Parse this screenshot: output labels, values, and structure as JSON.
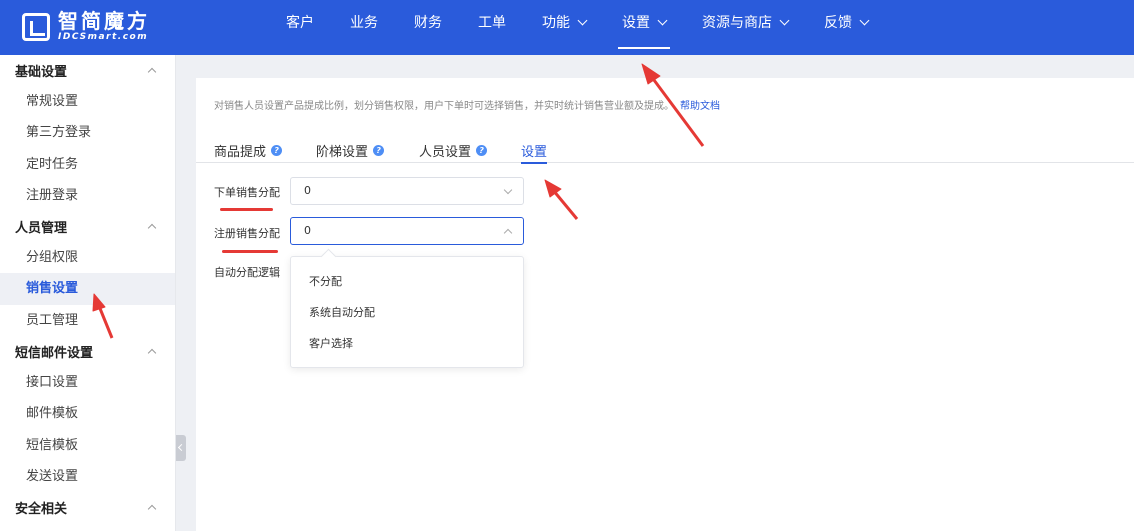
{
  "logo": {
    "title": "智简魔方",
    "subtitle": "IDCSmart.com"
  },
  "nav": [
    {
      "label": "客户",
      "dropdown": false,
      "active": false
    },
    {
      "label": "业务",
      "dropdown": false,
      "active": false
    },
    {
      "label": "财务",
      "dropdown": false,
      "active": false
    },
    {
      "label": "工单",
      "dropdown": false,
      "active": false
    },
    {
      "label": "功能",
      "dropdown": true,
      "active": false
    },
    {
      "label": "设置",
      "dropdown": true,
      "active": true
    },
    {
      "label": "资源与商店",
      "dropdown": true,
      "active": false
    },
    {
      "label": "反馈",
      "dropdown": true,
      "active": false
    }
  ],
  "sidebar": {
    "groups": [
      {
        "title": "基础设置",
        "items": [
          "常规设置",
          "第三方登录",
          "定时任务",
          "注册登录"
        ]
      },
      {
        "title": "人员管理",
        "items": [
          "分组权限",
          "销售设置",
          "员工管理"
        ]
      },
      {
        "title": "短信邮件设置",
        "items": [
          "接口设置",
          "邮件模板",
          "短信模板",
          "发送设置"
        ]
      },
      {
        "title": "安全相关",
        "items": []
      }
    ],
    "active_item": "销售设置"
  },
  "main": {
    "description": "对销售人员设置产品提成比例，划分销售权限，用户下单时可选择销售，并实时统计销售营业额及提成。",
    "help_link": "帮助文档",
    "tabs": [
      {
        "label": "商品提成",
        "help": true
      },
      {
        "label": "阶梯设置",
        "help": true
      },
      {
        "label": "人员设置",
        "help": true
      },
      {
        "label": "设置",
        "help": false
      }
    ],
    "active_tab": "设置",
    "form": {
      "order_sales_label": "下单销售分配",
      "order_sales_value": "0",
      "register_sales_label": "注册销售分配",
      "register_sales_value": "0",
      "auto_assign_label": "自动分配逻辑"
    },
    "dropdown_options": [
      "不分配",
      "系统自动分配",
      "客户选择"
    ]
  },
  "colors": {
    "primary": "#2a5bdb",
    "annotation": "#e53935"
  }
}
